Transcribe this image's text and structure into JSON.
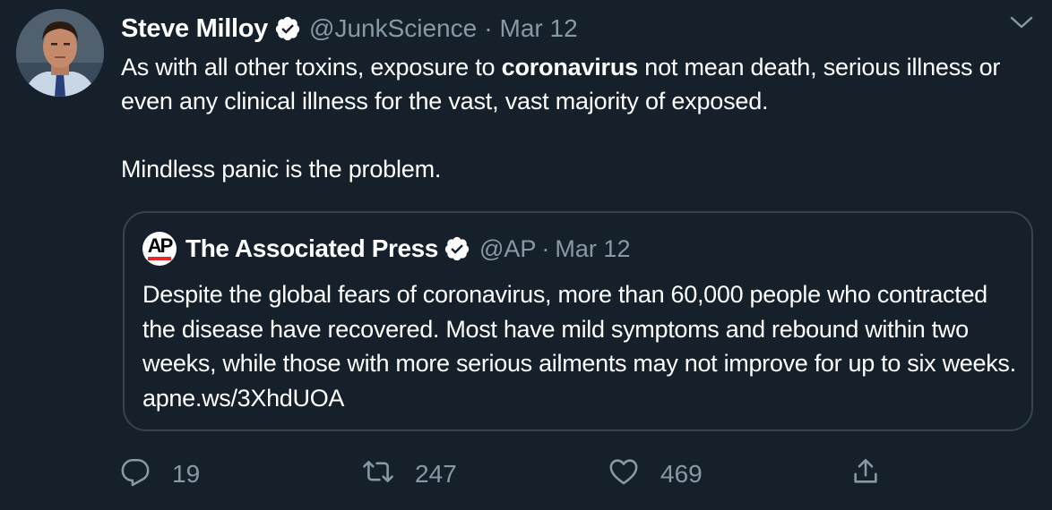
{
  "tweet": {
    "author": {
      "display_name": "Steve Milloy",
      "handle": "@JunkScience",
      "verified": true
    },
    "separator": "·",
    "date": "Mar 12",
    "text": {
      "line1_pre": "As with all other toxins, exposure to ",
      "line1_bold": "coronavirus",
      "line1_post": " not mean death, serious illness or even any clinical illness for the vast, vast majority of exposed.",
      "line2": "Mindless panic is the problem."
    },
    "quoted": {
      "logo_text": "AP",
      "display_name": "The Associated Press",
      "handle": "@AP",
      "separator": "·",
      "date": "Mar 12",
      "verified": true,
      "text": "Despite the global fears of coronavirus, more than 60,000 people who contracted the disease have recovered. Most have mild symptoms and rebound within two weeks, while those with more serious ailments may not improve for up to six weeks. apne.ws/3XhdUOA"
    },
    "actions": {
      "replies": "19",
      "retweets": "247",
      "likes": "469"
    }
  },
  "icons": {
    "verified": "verified-badge-icon",
    "caret": "chevron-down-icon",
    "reply": "reply-icon",
    "retweet": "retweet-icon",
    "like": "heart-icon",
    "share": "share-icon"
  },
  "colors": {
    "background": "#15202b",
    "muted": "#8899a6",
    "border": "#38444d",
    "text": "#ffffff"
  }
}
